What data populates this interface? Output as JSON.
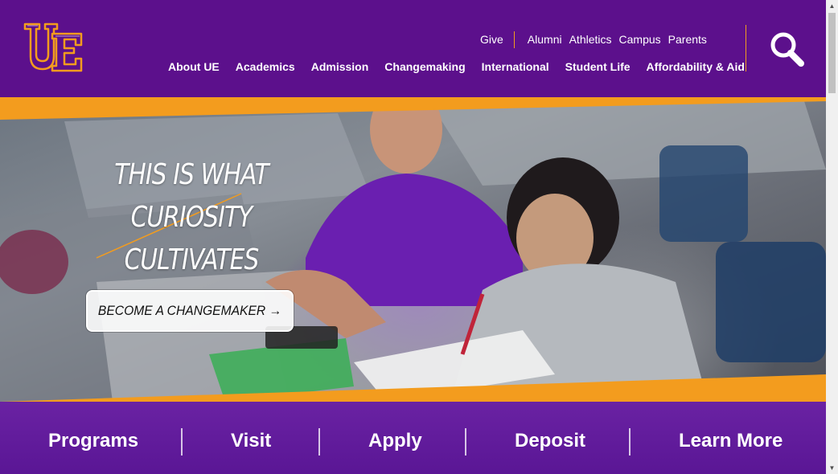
{
  "header": {
    "logo_text": "UE",
    "utility_links": [
      "Give",
      "Alumni",
      "Athletics",
      "Campus",
      "Parents"
    ],
    "main_nav": [
      "About UE",
      "Academics",
      "Admission",
      "Changemaking",
      "International",
      "Student Life",
      "Affordability & Aid"
    ],
    "search_icon": "search-icon"
  },
  "hero": {
    "tagline": [
      "THIS IS WHAT",
      "CURIOSITY",
      "CULTIVATES"
    ],
    "cta_label": "BECOME A CHANGEMAKER →"
  },
  "quick_links": [
    "Programs",
    "Visit",
    "Apply",
    "Deposit",
    "Learn More"
  ],
  "colors": {
    "brand_purple": "#5c108c",
    "accent_orange": "#f39c1e",
    "quick_bar_purple": "#6a22a3"
  }
}
